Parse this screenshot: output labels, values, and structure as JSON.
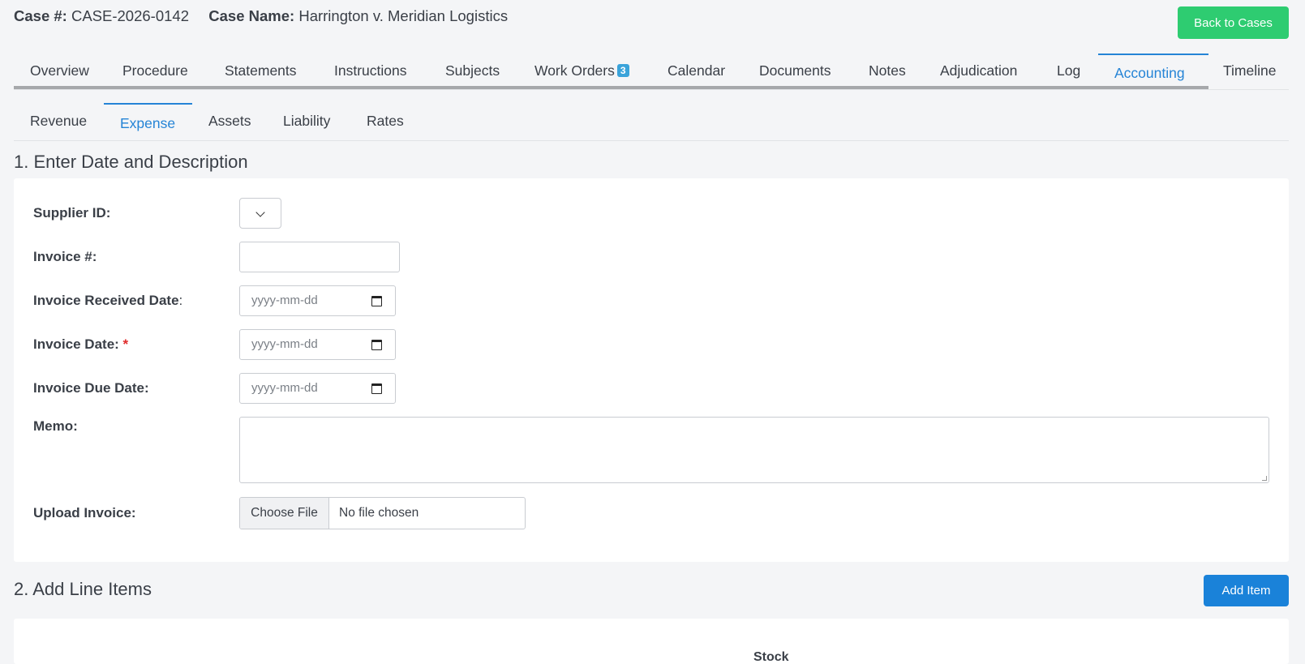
{
  "header": {
    "case_no_label": "Case #:",
    "case_no": "CASE-2026-0142",
    "case_name_label": "Case Name:",
    "case_name": "Harrington v. Meridian Logistics",
    "back_button": "Back to Cases"
  },
  "main_tabs": [
    {
      "label": "Overview"
    },
    {
      "label": "Procedure"
    },
    {
      "label": "Statements"
    },
    {
      "label": "Instructions"
    },
    {
      "label": "Subjects"
    },
    {
      "label": "Work Orders",
      "badge": "3"
    },
    {
      "label": "Calendar"
    },
    {
      "label": "Documents"
    },
    {
      "label": "Notes"
    },
    {
      "label": "Adjudication"
    },
    {
      "label": "Log"
    },
    {
      "label": "Accounting",
      "active": true
    },
    {
      "label": "Timeline"
    }
  ],
  "sub_tabs": [
    {
      "label": "Revenue"
    },
    {
      "label": "Expense",
      "active": true
    },
    {
      "label": "Assets"
    },
    {
      "label": "Liability"
    },
    {
      "label": "Rates"
    }
  ],
  "section1": {
    "title": "1. Enter Date and Description",
    "supplier_label": "Supplier ID:",
    "supplier_value": "",
    "invoice_no_label": "Invoice #:",
    "invoice_no_value": "",
    "received_label": "Invoice Received Date",
    "received_colon": ":",
    "invoice_date_label": "Invoice Date:",
    "required_mark": "*",
    "due_label": "Invoice Due Date:",
    "date_placeholder": "yyyy-mm-dd",
    "memo_label": "Memo:",
    "memo_value": "",
    "upload_label": "Upload Invoice:",
    "choose_file": "Choose File",
    "no_file": "No file chosen"
  },
  "section2": {
    "title": "2. Add Line Items",
    "add_button": "Add Item",
    "column_stock": "Stock"
  },
  "colors": {
    "accent": "#2584d6",
    "success": "#2ecc71",
    "primary_button": "#1a82d9",
    "required": "#e02b2b"
  }
}
